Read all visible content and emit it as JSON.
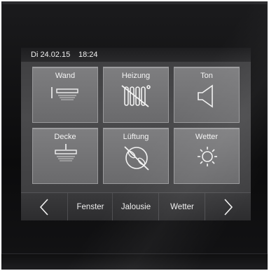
{
  "status": {
    "date": "Di 24.02.15",
    "time": "18:24"
  },
  "tiles": [
    {
      "label": "Wand",
      "icon": "wall-light-icon"
    },
    {
      "label": "Heizung",
      "icon": "heating-off-icon"
    },
    {
      "label": "Ton",
      "icon": "speaker-icon"
    },
    {
      "label": "Decke",
      "icon": "ceiling-light-icon"
    },
    {
      "label": "Lüftung",
      "icon": "ventilation-off-icon"
    },
    {
      "label": "Wetter",
      "icon": "sun-icon"
    }
  ],
  "nav": {
    "prev_icon": "chevron-left-icon",
    "items": [
      "Fenster",
      "Jalousie",
      "Wetter"
    ],
    "next_icon": "chevron-right-icon"
  },
  "colors": {
    "tile": "#7a7a7c",
    "screen": "#444446",
    "frame": "#111113",
    "text": "#f2f2f2"
  }
}
